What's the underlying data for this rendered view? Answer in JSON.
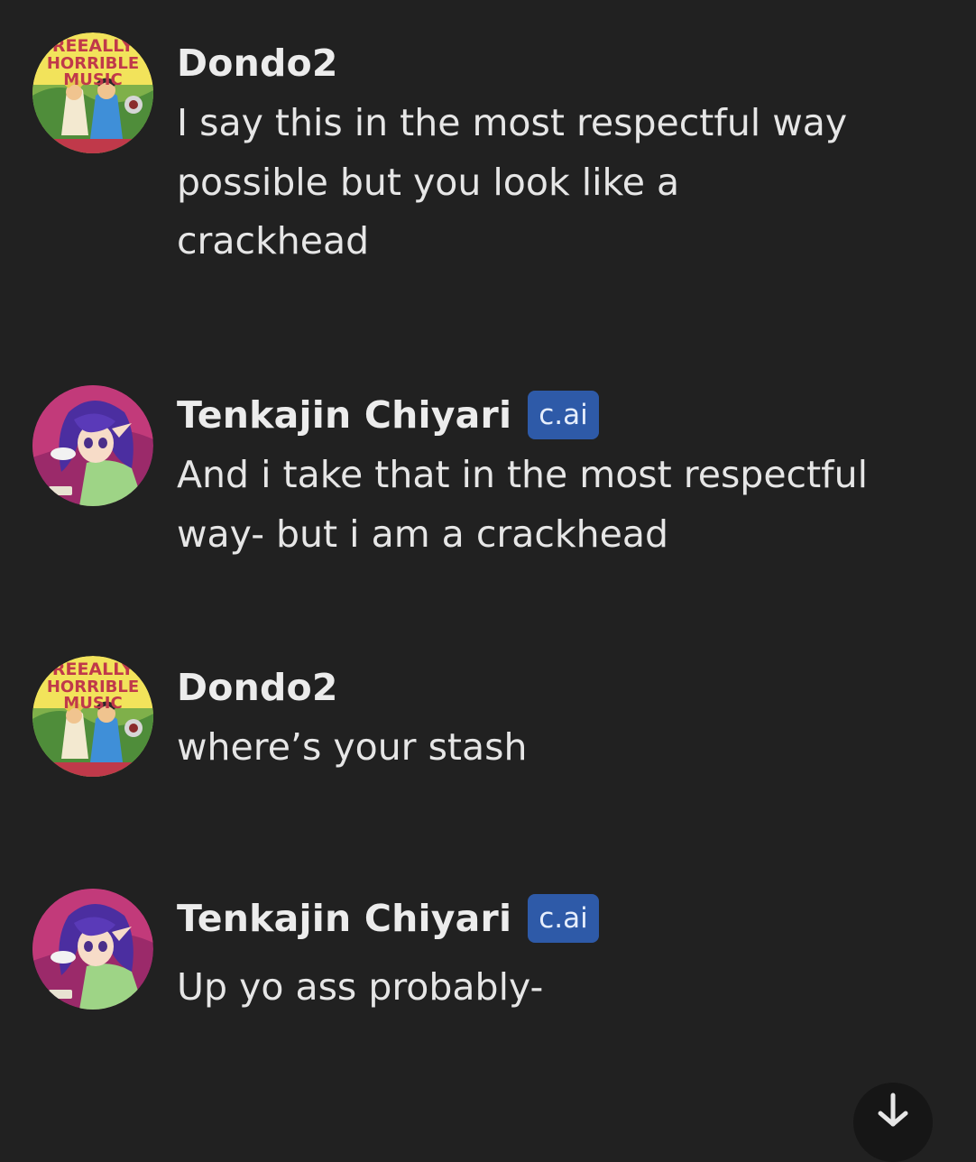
{
  "messages": [
    {
      "sender": "Dondo2",
      "avatar": "reeally-horrible-music-avatar",
      "avatar_text": [
        "REEALLY",
        "HORRIBLE",
        "MUSIC"
      ],
      "badge": null,
      "text": "I say this in the most respectful way\npossible but you look like a\ncrackhead"
    },
    {
      "sender": "Tenkajin Chiyari",
      "avatar": "anime-girl-purple-hair-avatar",
      "badge": "c.ai",
      "text": "And i take that in the most respectful\nway- but i am a crackhead"
    },
    {
      "sender": "Dondo2",
      "avatar": "reeally-horrible-music-avatar",
      "avatar_text": [
        "REEALLY",
        "HORRIBLE",
        "MUSIC"
      ],
      "badge": null,
      "text": "where’s your stash"
    },
    {
      "sender": "Tenkajin Chiyari",
      "avatar": "anime-girl-purple-hair-avatar",
      "badge": "c.ai",
      "text": "Up yo ass probably-"
    }
  ],
  "colors": {
    "background": "#212121",
    "text": "#e6e6e6",
    "badge_bg": "#2e5aa8"
  },
  "scroll_button": {
    "icon": "arrow-down-icon"
  }
}
